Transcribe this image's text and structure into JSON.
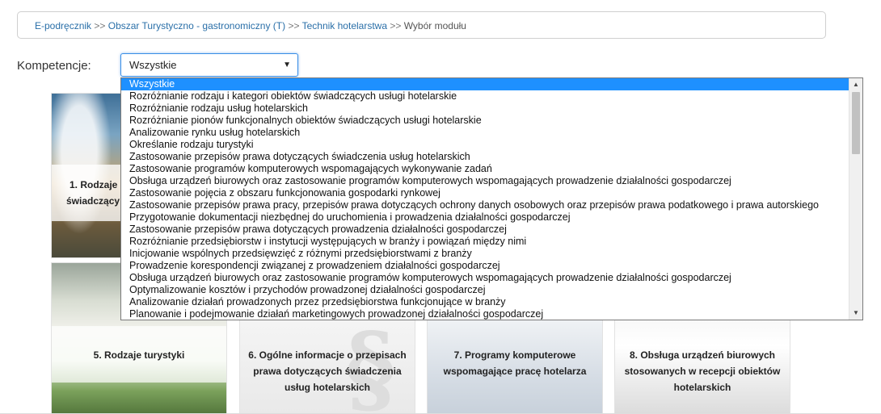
{
  "breadcrumb": {
    "items": [
      "E-podręcznik",
      "Obszar Turystyczno - gastronomiczny (T)",
      "Technik hotelarstwa"
    ],
    "current": "Wybór modułu",
    "separator": ">>"
  },
  "filter": {
    "label": "Kompetencje:",
    "selected": "Wszystkie",
    "arrow": "▼"
  },
  "dropdown_options": [
    "Wszystkie",
    "Rozróżnianie rodzaju i kategori obiektów świadczących usługi hotelarskie",
    "Rozróżnianie rodzaju usług hotelarskich",
    "Rozróżnianie pionów funkcjonalnych obiektów świadczących usługi hotelarskie",
    "Analizowanie rynku usług hotelarskich",
    "Określanie rodzaju turystyki",
    "Zastosowanie przepisów prawa dotyczących świadczenia usług hotelarskich",
    "Zastosowanie programów komputerowych wspomagających wykonywanie zadań",
    "Obsługa urządzeń biurowych oraz zastosowanie programów komputerowych wspomagających prowadzenie działalności gospodarczej",
    "Zastosowanie pojęcia z obszaru funkcjonowania gospodarki rynkowej",
    "Zastosowanie przepisów prawa pracy, przepisów prawa dotyczących ochrony danych osobowych oraz przepisów prawa podatkowego i prawa autorskiego",
    "Przygotowanie dokumentacji niezbędnej do uruchomienia i prowadzenia działalności gospodarczej",
    "Zastosowanie przepisów prawa dotyczących prowadzenia działalności gospodarczej",
    "Rozróżnianie przedsiębiorstw i instytucji występujących w branży i powiązań między nimi",
    "Inicjowanie wspólnych przedsięwzięć z różnymi przedsiębiorstwami z branży",
    "Prowadzenie korespondencji związanej z prowadzeniem działalności gospodarczej",
    "Obsługa urządzeń biurowych oraz zastosowanie programów komputerowych wspomagających prowadzenie działalności gospodarczej",
    "Optymalizowanie kosztów i przychodów prowadzonej działalności gospodarczej",
    "Analizowanie działań prowadzonych przez przedsiębiorstwa funkcjonujące w branży",
    "Planowanie i podejmowanie działań marketingowych prowadzonej działalności gospodarczej"
  ],
  "tiles": {
    "t1_line1": "1. Rodzaje",
    "t1_line2": "świadczący",
    "t5": "5. Rodzaje turystyki",
    "t6": "6. Ogólne informacje o przepisach prawa dotyczących świadczenia usług hotelarskich",
    "t7": "7. Programy komputerowe wspomagające pracę hotelarza",
    "t8": "8. Obsługa urządzeń biurowych stosowanych w recepcji obiektów hotelarskich"
  },
  "colors": {
    "link": "#2a6fa8",
    "selected_option": "#1e90ff"
  }
}
